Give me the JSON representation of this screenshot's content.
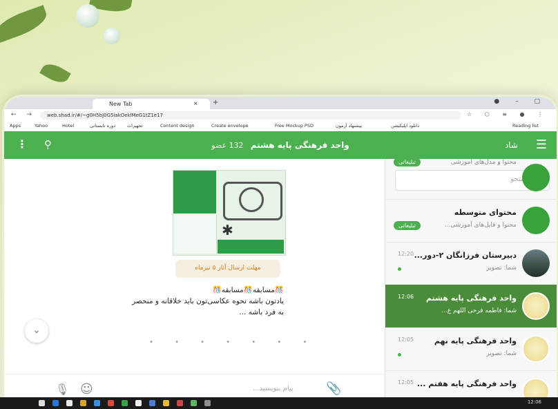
{
  "browser": {
    "tab_title": "New Tab",
    "url": "web.shad.ir/#/~g0H5bJ0G5iakOeklMeG1tZ1e17",
    "bookmarks": [
      "Apps",
      "Yahoo",
      "Hotel",
      "دوره تابستانی",
      "تجهیزات",
      "Content design",
      "Create envelope",
      "Free Mockup PSD",
      "پیشنهاد آزمون",
      "دانلود اپلیکیشن",
      "Reading list"
    ]
  },
  "app": {
    "brand": "شاد",
    "group_title": "واحد فرهنگی پایه هشتم",
    "member_count": "132 عضو"
  },
  "sidebar": {
    "search_placeholder": "جستجو",
    "chats": [
      {
        "name": "",
        "preview": "محتوا و مدل‌های آموزشی",
        "time": "",
        "badge": "تبلیغاتی"
      },
      {
        "name": "محتوای متوسطه",
        "preview": "محتوا و فایل‌های آموزشی...",
        "time": "",
        "badge": "تبلیغاتی"
      },
      {
        "name": "دبیرستان فرزانگان ۲-دور...",
        "preview": "شما: تصویر",
        "time": "12:20",
        "badge": ""
      },
      {
        "name": "واحد فرهنگی پایه هشتم",
        "preview": "شما: فاطمه فرحی اللهم ع...",
        "time": "12:06",
        "badge": ""
      },
      {
        "name": "واحد فرهنگی پایه نهم",
        "preview": "شما: تصویر",
        "time": "12:05",
        "badge": ""
      },
      {
        "name": "واحد فرهنگی پایه هفتم ...",
        "preview": "",
        "time": "12:05",
        "badge": ""
      }
    ]
  },
  "conversation": {
    "image_caption": "مهلت ارسال آثار ۵ تیرماه",
    "message_line1": "🎊مسابقه🎊مسابقه🎊",
    "message_line2": "یادتون باشه نحوه عکاسی‌تون باید خلاقانه و منحصر",
    "message_line3": "به فرد باشه ...",
    "composer_placeholder": "پیام بنویسید...",
    "scroll_down_label": "⌄"
  },
  "taskbar": {
    "clock": "12:06"
  },
  "colors": {
    "header_green": "#4caf50",
    "active_chat": "#4a8c3a"
  }
}
